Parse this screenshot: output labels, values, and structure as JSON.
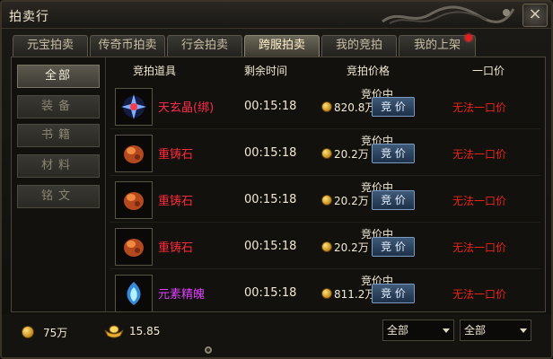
{
  "window": {
    "title": "拍卖行",
    "close_symbol": "×"
  },
  "tabs": [
    {
      "label": "元宝拍卖",
      "active": false
    },
    {
      "label": "传奇币拍卖",
      "active": false
    },
    {
      "label": "行会拍卖",
      "active": false
    },
    {
      "label": "跨服拍卖",
      "active": true
    },
    {
      "label": "我的竞拍",
      "active": false
    },
    {
      "label": "我的上架",
      "active": false,
      "notification": true
    }
  ],
  "sidebar": {
    "items": [
      {
        "label": "全部",
        "active": true
      },
      {
        "label": "装备",
        "active": false
      },
      {
        "label": "书籍",
        "active": false
      },
      {
        "label": "材料",
        "active": false
      },
      {
        "label": "铭文",
        "active": false
      }
    ]
  },
  "table": {
    "headers": {
      "item": "竞拍道具",
      "time_left": "剩余时间",
      "bid_price": "竞拍价格",
      "buyout": "一口价"
    },
    "rows": [
      {
        "name": "天玄晶(绑)",
        "name_color": "#ff2a4a",
        "icon": "crystal-icon",
        "time": "00:15:18",
        "status": "竞价中",
        "price": "820.8万",
        "bid_label": "竞 价",
        "buyout": "无法一口价"
      },
      {
        "name": "重铸石",
        "name_color": "#ff2a3a",
        "icon": "ore-icon",
        "time": "00:15:18",
        "status": "竞价中",
        "price": "20.2万",
        "bid_label": "竞 价",
        "buyout": "无法一口价"
      },
      {
        "name": "重铸石",
        "name_color": "#ff2a3a",
        "icon": "ore-icon",
        "time": "00:15:18",
        "status": "竞价中",
        "price": "20.2万",
        "bid_label": "竞 价",
        "buyout": "无法一口价"
      },
      {
        "name": "重铸石",
        "name_color": "#ff2a3a",
        "icon": "ore-icon",
        "time": "00:15:18",
        "status": "竞价中",
        "price": "20.2万",
        "bid_label": "竞 价",
        "buyout": "无法一口价"
      },
      {
        "name": "元素精魄",
        "name_color": "#e040ff",
        "icon": "essence-icon",
        "time": "00:15:18",
        "status": "竞价中",
        "price": "811.2万",
        "bid_label": "竞 价",
        "buyout": "无法一口价"
      }
    ]
  },
  "footer": {
    "gold": "75万",
    "ingot": "15.85",
    "filter1": "全部",
    "filter2": "全部"
  }
}
